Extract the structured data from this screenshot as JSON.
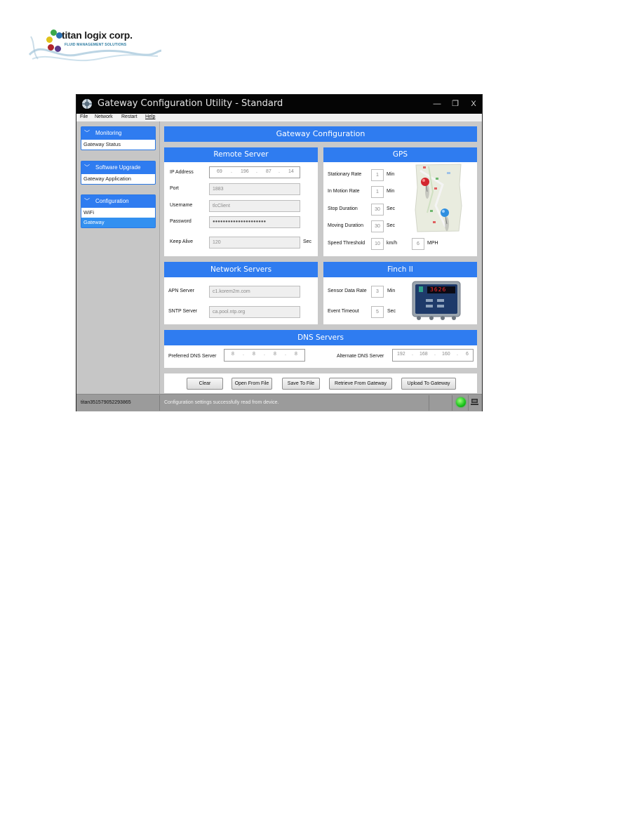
{
  "logo": {
    "brand": "titan logix corp.",
    "tagline": "FLUID MANAGEMENT SOLUTIONS",
    "dot_colors": [
      "#3aa84a",
      "#2a6fb0",
      "#e0c21a",
      "#b0242c",
      "#5a3a8a"
    ]
  },
  "window": {
    "title": "Gateway Configuration Utility - Standard",
    "controls": {
      "minimize": "—",
      "maximize": "❐",
      "close": "X"
    },
    "menu": [
      "File",
      "Network",
      "Restart",
      "Help"
    ]
  },
  "sidebar": {
    "groups": [
      {
        "title": "Monitoring",
        "icon": "chevron-down-icon",
        "items": [
          {
            "label": "Gateway Status",
            "selected": false
          }
        ]
      },
      {
        "title": "Software Upgrade",
        "icon": "chevron-down-icon",
        "items": [
          {
            "label": "Gateway Application",
            "selected": false
          }
        ]
      },
      {
        "title": "Configuration",
        "icon": "chevron-down-icon",
        "items": [
          {
            "label": "WiFi",
            "selected": false
          },
          {
            "label": "Gateway",
            "selected": true
          }
        ]
      }
    ]
  },
  "main": {
    "title": "Gateway Configuration",
    "remote_server": {
      "title": "Remote Server",
      "ip_label": "IP Address",
      "ip": [
        "69",
        "196",
        "87",
        "14"
      ],
      "port_label": "Port",
      "port": "1883",
      "username_label": "Username",
      "username": "tlcClient",
      "password_label": "Password",
      "password": "●●●●●●●●●●●●●●●●●●●●●",
      "keepalive_label": "Keep Alive",
      "keepalive": "120",
      "keepalive_unit": "Sec"
    },
    "gps": {
      "title": "GPS",
      "stationary_label": "Stationary Rate",
      "stationary": "1",
      "stationary_unit": "Min",
      "motion_label": "In Motion Rate",
      "motion": "1",
      "motion_unit": "Min",
      "stop_label": "Stop Duration",
      "stop": "30",
      "stop_unit": "Sec",
      "moving_label": "Moving Duration",
      "moving": "30",
      "moving_unit": "Sec",
      "speed_label": "Speed Threshold",
      "speed_kmh": "10",
      "speed_kmh_unit": "km/h",
      "speed_mph": "6",
      "speed_mph_unit": "MPH",
      "image": "map-with-pins-icon"
    },
    "network_servers": {
      "title": "Network Servers",
      "apn_label": "APN Server",
      "apn": "c1.korem2m.com",
      "sntp_label": "SNTP Server",
      "sntp": "ca.pool.ntp.org"
    },
    "finch": {
      "title": "Finch II",
      "sensor_label": "Sensor Data Rate",
      "sensor": "3",
      "sensor_unit": "Min",
      "event_label": "Event Timeout",
      "event": "5",
      "event_unit": "Sec",
      "device_display": "3626",
      "image": "finch-device-icon"
    },
    "dns": {
      "title": "DNS Servers",
      "preferred_label": "Preferred DNS Server",
      "preferred": [
        "8",
        "8",
        "8",
        "8"
      ],
      "alternate_label": "Alternate DNS Server",
      "alternate": [
        "192",
        "168",
        "160",
        "6"
      ]
    },
    "buttons": {
      "clear": "Clear",
      "open": "Open From File",
      "save": "Save To File",
      "retrieve": "Retrieve From Gateway",
      "upload": "Upload To Gateway"
    }
  },
  "statusbar": {
    "device_id": "titan351579052293865",
    "message": "Configuration settings successfully read from device.",
    "connection_status": "connected",
    "status_color": "#18c21a"
  },
  "colors": {
    "accent": "#2f7cf0",
    "titlebar": "#050505",
    "selected_item": "#3390f0"
  }
}
